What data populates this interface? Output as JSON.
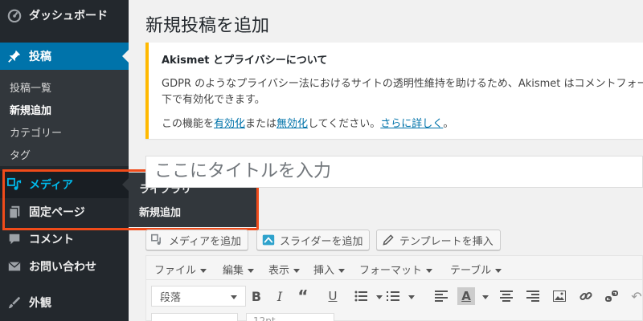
{
  "sidebar": {
    "items": [
      {
        "id": "dashboard",
        "label": "ダッシュボード",
        "icon": "dashboard-icon"
      },
      {
        "id": "posts",
        "label": "投稿",
        "icon": "pin-icon"
      },
      {
        "id": "media",
        "label": "メディア",
        "icon": "media-icon"
      },
      {
        "id": "pages",
        "label": "固定ページ",
        "icon": "page-icon"
      },
      {
        "id": "comments",
        "label": "コメント",
        "icon": "comment-icon"
      },
      {
        "id": "contact",
        "label": "お問い合わせ",
        "icon": "mail-icon"
      },
      {
        "id": "appearance",
        "label": "外観",
        "icon": "brush-icon"
      }
    ],
    "posts_submenu": [
      "投稿一覧",
      "新規追加",
      "カテゴリー",
      "タグ"
    ],
    "media_flyout": [
      "ライブラリ",
      "新規追加"
    ]
  },
  "main": {
    "page_title": "新規投稿を追加",
    "notice": {
      "title": "Akismet とプライバシーについて",
      "line1": "GDPR のようなプライバシー法におけるサイトの透明性維持を助けるため、Akismet はコメントフォー",
      "line2": "下で有効化できます。",
      "line3_prefix": "この機能を",
      "enable_link": "有効化",
      "line3_mid": "または",
      "disable_link": "無効化",
      "line3_mid2": "してください。",
      "learn_more_link": "さらに詳しく",
      "line3_suffix": "。"
    },
    "title_placeholder": "ここにタイトルを入力"
  },
  "media_buttons": [
    {
      "label": "メディアを追加",
      "icon": "media-icon"
    },
    {
      "label": "スライダーを追加",
      "icon": "slider-icon"
    },
    {
      "label": "テンプレートを挿入",
      "icon": "pencil-icon"
    }
  ],
  "editor": {
    "menus": [
      "ファイル",
      "編集",
      "表示",
      "挿入",
      "フォーマット",
      "テーブル"
    ],
    "format_select": "段落",
    "row2_select": "12pt"
  },
  "colors": {
    "sidebar_bg": "#23282d",
    "active_blue": "#0073aa",
    "notice_border": "#ffb900",
    "highlight": "#f04b1a",
    "link": "#0073aa"
  }
}
